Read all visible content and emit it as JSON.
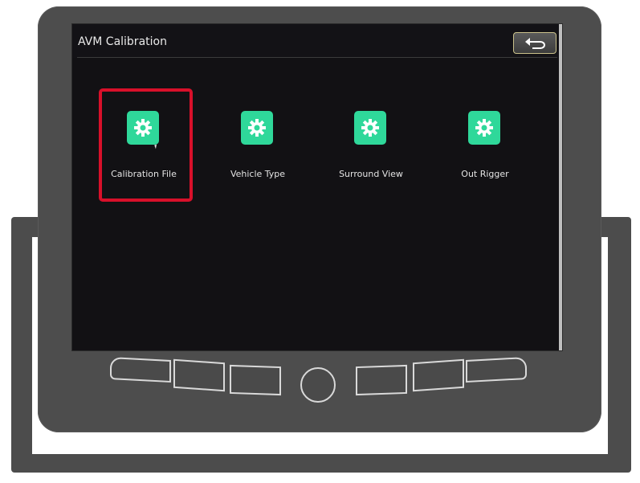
{
  "screen": {
    "title": "AVM Calibration",
    "back_icon": "back-arrow-icon"
  },
  "tiles": [
    {
      "label": "Calibration File",
      "icon": "gear-icon",
      "selected": true
    },
    {
      "label": "Vehicle Type",
      "icon": "gear-icon",
      "selected": false
    },
    {
      "label": "Surround View",
      "icon": "gear-icon",
      "selected": false
    },
    {
      "label": "Out Rigger",
      "icon": "gear-icon",
      "selected": false
    }
  ],
  "colors": {
    "icon_tile": "#2fd89a",
    "highlight": "#d8102a",
    "screen_bg": "#121114",
    "bezel": "#4d4d4d"
  }
}
